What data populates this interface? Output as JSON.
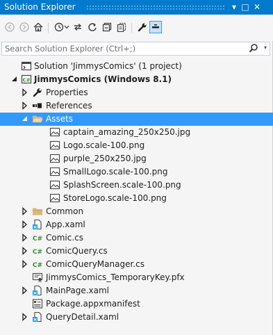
{
  "window": {
    "title": "Solution Explorer",
    "pin_glyph": "▾",
    "close_glyph": "✕",
    "max_glyph": "□"
  },
  "search": {
    "placeholder": "Search Solution Explorer (Ctrl+;)"
  },
  "tree": {
    "solution": "Solution 'JimmysComics' (1 project)",
    "project": "JimmysComics (Windows 8.1)",
    "properties": "Properties",
    "references": "References",
    "assets": "Assets",
    "asset_files": [
      "captain_amazing_250x250.jpg",
      "Logo.scale-100.png",
      "purple_250x250.jpg",
      "SmallLogo.scale-100.png",
      "SplashScreen.scale-100.png",
      "StoreLogo.scale-100.png"
    ],
    "common": "Common",
    "app_xaml": "App.xaml",
    "comic_cs": "Comic.cs",
    "comicquery_cs": "ComicQuery.cs",
    "comicquerymanager_cs": "ComicQueryManager.cs",
    "temp_key": "JimmysComics_TemporaryKey.pfx",
    "mainpage_xaml": "MainPage.xaml",
    "package_manifest": "Package.appxmanifest",
    "querydetail_xaml": "QueryDetail.xaml"
  },
  "colors": {
    "accent": "#007acc",
    "selection": "#3399ff",
    "folder": "#dcb67a",
    "csharp": "#388a34"
  }
}
